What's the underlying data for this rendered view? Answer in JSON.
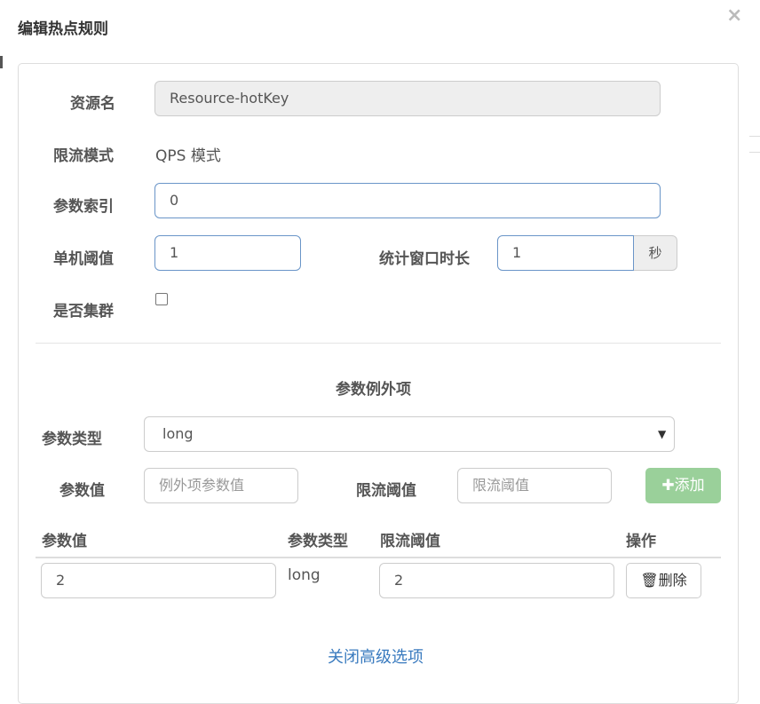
{
  "dialog": {
    "title": "编辑热点规则",
    "close": "×"
  },
  "form": {
    "resource_label": "资源名",
    "resource_value": "Resource-hotKey",
    "mode_label": "限流模式",
    "mode_value": "QPS 模式",
    "param_index_label": "参数索引",
    "param_index_value": "0",
    "single_threshold_label": "单机阈值",
    "single_threshold_value": "1",
    "window_label": "统计窗口时长",
    "window_value": "1",
    "window_unit": "秒",
    "cluster_label": "是否集群",
    "cluster_checked": false
  },
  "exceptions": {
    "section_title": "参数例外项",
    "param_type_label": "参数类型",
    "param_type_value": "long",
    "param_value_label": "参数值",
    "param_value_placeholder": "例外项参数值",
    "limit_label": "限流阈值",
    "limit_placeholder": "限流阈值",
    "add_button": "添加",
    "table": {
      "headers": [
        "参数值",
        "参数类型",
        "限流阈值",
        "操作"
      ],
      "rows": [
        {
          "value": "2",
          "type": "long",
          "threshold": "2",
          "action": "删除"
        }
      ]
    }
  },
  "footer": {
    "toggle_link": "关闭高级选项"
  }
}
